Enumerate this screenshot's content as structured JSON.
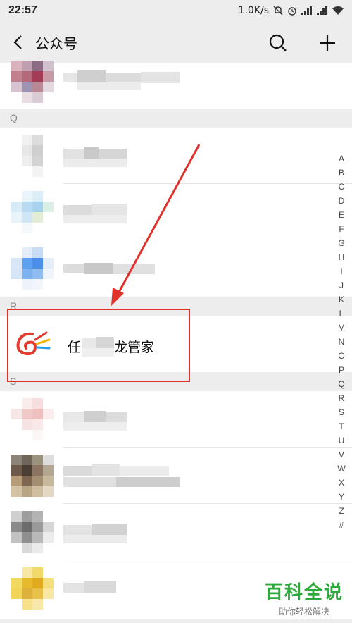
{
  "status": {
    "time": "22:57",
    "speed": "1.0K/s"
  },
  "header": {
    "title": "公众号",
    "back_icon": "chevron-left-icon",
    "search_icon": "search-icon",
    "add_icon": "plus-icon"
  },
  "sections": {
    "q": "Q",
    "r": "R",
    "s": "S"
  },
  "highlighted_item": {
    "name_prefix": "任",
    "name_suffix": "龙管家"
  },
  "alphabet": [
    "A",
    "B",
    "C",
    "D",
    "E",
    "F",
    "G",
    "H",
    "I",
    "J",
    "K",
    "L",
    "M",
    "N",
    "O",
    "P",
    "Q",
    "R",
    "S",
    "T",
    "U",
    "V",
    "W",
    "X",
    "Y",
    "Z",
    "#"
  ],
  "watermark": {
    "main": "百科全说",
    "sub": "助你轻松解决"
  },
  "colors": {
    "accent_red": "#e0312b",
    "watermark_green": "#2dab3a"
  }
}
